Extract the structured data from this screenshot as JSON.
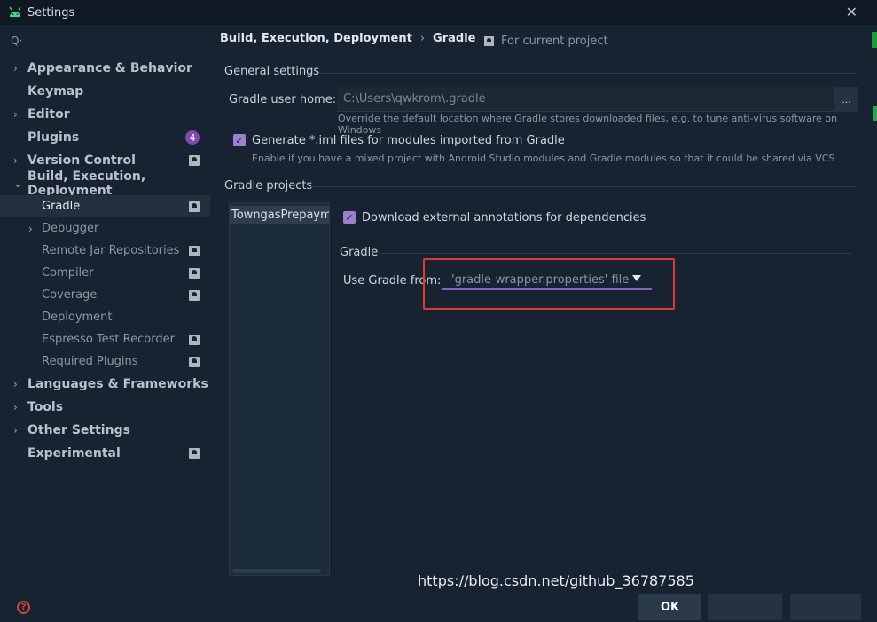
{
  "window": {
    "title": "Settings",
    "close_glyph": "✕"
  },
  "search": {
    "icon": "Q·"
  },
  "sidebar": {
    "items": [
      {
        "label": "Appearance & Behavior",
        "arrow": "›"
      },
      {
        "label": "Keymap"
      },
      {
        "label": "Editor",
        "arrow": "›"
      },
      {
        "label": "Plugins",
        "badge": "4"
      },
      {
        "label": "Version Control",
        "arrow": "›"
      },
      {
        "label": "Build, Execution, Deployment",
        "arrow": "⌄"
      },
      {
        "label": "Gradle"
      },
      {
        "label": "Debugger",
        "arrow": "›"
      },
      {
        "label": "Remote Jar Repositories"
      },
      {
        "label": "Compiler"
      },
      {
        "label": "Coverage"
      },
      {
        "label": "Deployment"
      },
      {
        "label": "Espresso Test Recorder"
      },
      {
        "label": "Required Plugins"
      },
      {
        "label": "Languages & Frameworks",
        "arrow": "›"
      },
      {
        "label": "Tools",
        "arrow": "›"
      },
      {
        "label": "Other Settings",
        "arrow": "›"
      },
      {
        "label": "Experimental"
      }
    ],
    "help_glyph": "?"
  },
  "breadcrumb": {
    "parent": "Build, Execution, Deployment",
    "separator": "›",
    "current": "Gradle"
  },
  "for_project": "For current project",
  "general_settings": {
    "title": "General settings",
    "gradle_home_label": "Gradle user home:",
    "gradle_home_value": "C:\\Users\\qwkrom\\.gradle",
    "browse_label": "...",
    "gradle_home_hint": "Override the default location where Gradle stores downloaded files, e.g. to tune anti-virus software on Windows",
    "iml_checkbox_label": "Generate *.iml files for modules imported from Gradle",
    "iml_hint": "Enable if you have a mixed project with Android Studio modules and Gradle modules so that it could be shared via VCS",
    "check_glyph": "✓"
  },
  "gradle_projects": {
    "title": "Gradle projects",
    "project_name": "TowngasPrepayme",
    "download_annotations_label": "Download external annotations for dependencies",
    "gradle_section_title": "Gradle",
    "use_gradle_from_label": "Use Gradle from:",
    "use_gradle_from_value": "'gradle-wrapper.properties' file"
  },
  "buttons": {
    "ok": "OK"
  },
  "watermark": "https://blog.csdn.net/github_36787585",
  "colors": {
    "background": "#172330",
    "accent": "#9d7fd0",
    "highlight": "#e03a2f"
  }
}
